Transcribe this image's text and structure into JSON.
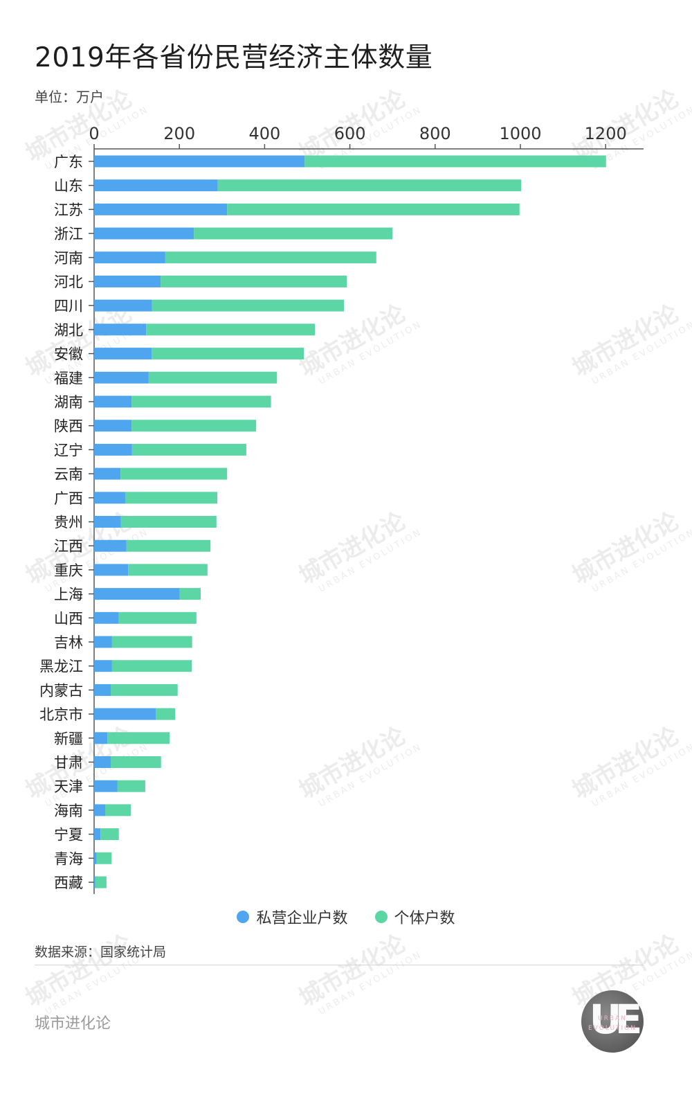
{
  "header": {
    "title": "2019年各省份民营经济主体数量",
    "unit": "单位：万户"
  },
  "legend": {
    "private": "私营企业户数",
    "individual": "个体户数"
  },
  "footer": {
    "source": "数据来源：国家统计局",
    "brand": "城市进化论",
    "logo_text": "UE",
    "logo_sub_1": "URBAN",
    "logo_sub_2": "EVOLUTION"
  },
  "watermark": {
    "cn": "城市进化论",
    "en": "URBAN EVOLUTION"
  },
  "colors": {
    "private": "#4fa6ee",
    "individual": "#5dd6a6",
    "axis": "#555555"
  },
  "chart_data": {
    "type": "bar",
    "orientation": "horizontal",
    "stacked": true,
    "title": "2019年各省份民营经济主体数量",
    "xlabel": "单位：万户",
    "ylabel": "",
    "xlim": [
      0,
      1300
    ],
    "xticks": [
      0,
      200,
      400,
      600,
      800,
      1000,
      1200
    ],
    "xaxis_position": "top",
    "grid": false,
    "legend_position": "bottom",
    "categories": [
      "广东",
      "山东",
      "江苏",
      "浙江",
      "河南",
      "河北",
      "四川",
      "湖北",
      "安徽",
      "福建",
      "湖南",
      "陕西",
      "辽宁",
      "云南",
      "广西",
      "贵州",
      "江西",
      "重庆",
      "上海",
      "山西",
      "吉林",
      "黑龙江",
      "内蒙古",
      "北京市",
      "新疆",
      "甘肃",
      "天津",
      "海南",
      "宁夏",
      "青海",
      "西藏"
    ],
    "series": [
      {
        "name": "私营企业户数",
        "values": [
          494,
          290,
          312,
          234,
          167,
          156,
          136,
          122,
          135,
          128,
          88,
          88,
          89,
          62,
          73,
          63,
          76,
          80,
          201,
          58,
          42,
          42,
          39,
          145,
          31,
          39,
          55,
          26,
          15,
          6,
          3
        ]
      },
      {
        "name": "个体户数",
        "values": [
          707,
          712,
          686,
          466,
          495,
          437,
          450,
          396,
          357,
          301,
          327,
          292,
          268,
          250,
          216,
          224,
          197,
          186,
          49,
          182,
          188,
          187,
          157,
          45,
          146,
          118,
          65,
          60,
          43,
          35,
          26
        ]
      }
    ]
  }
}
